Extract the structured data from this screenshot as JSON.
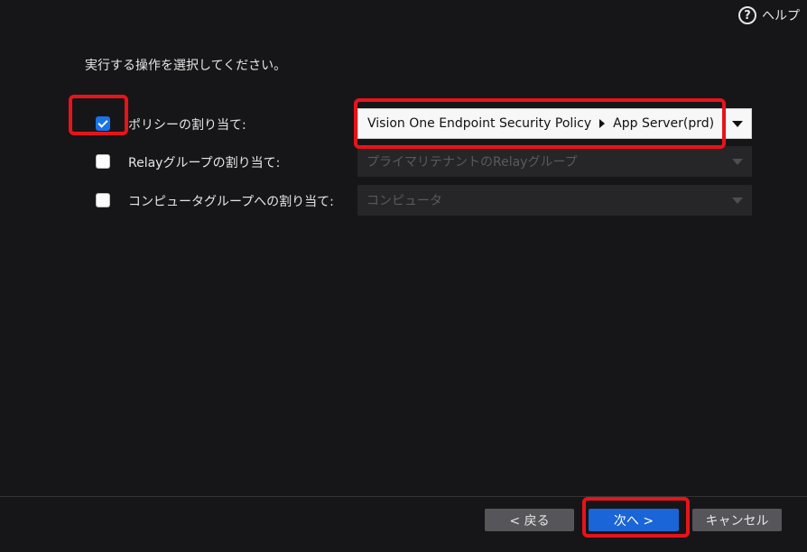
{
  "header": {
    "help_icon": "question-circle-icon",
    "help_label": "ヘルプ"
  },
  "instruction": "実行する操作を選択してください。",
  "options": [
    {
      "label": "ポリシーの割り当て:",
      "checked": true,
      "select_value_prefix": "Vision One Endpoint Security Policy",
      "select_value_suffix": "App Server(prd)",
      "enabled": true
    },
    {
      "label": "Relayグループの割り当て:",
      "checked": false,
      "select_value": "プライマリテナントのRelayグループ",
      "enabled": false
    },
    {
      "label": "コンピュータグループへの割り当て:",
      "checked": false,
      "select_value": "コンピュータ",
      "enabled": false
    }
  ],
  "footer": {
    "back_label": "< 戻る",
    "next_label": "次へ >",
    "cancel_label": "キャンセル"
  },
  "colors": {
    "background": "#161618",
    "highlight": "#e8131a",
    "primary": "#1a65d8",
    "checkbox_checked": "#1a73e8"
  }
}
